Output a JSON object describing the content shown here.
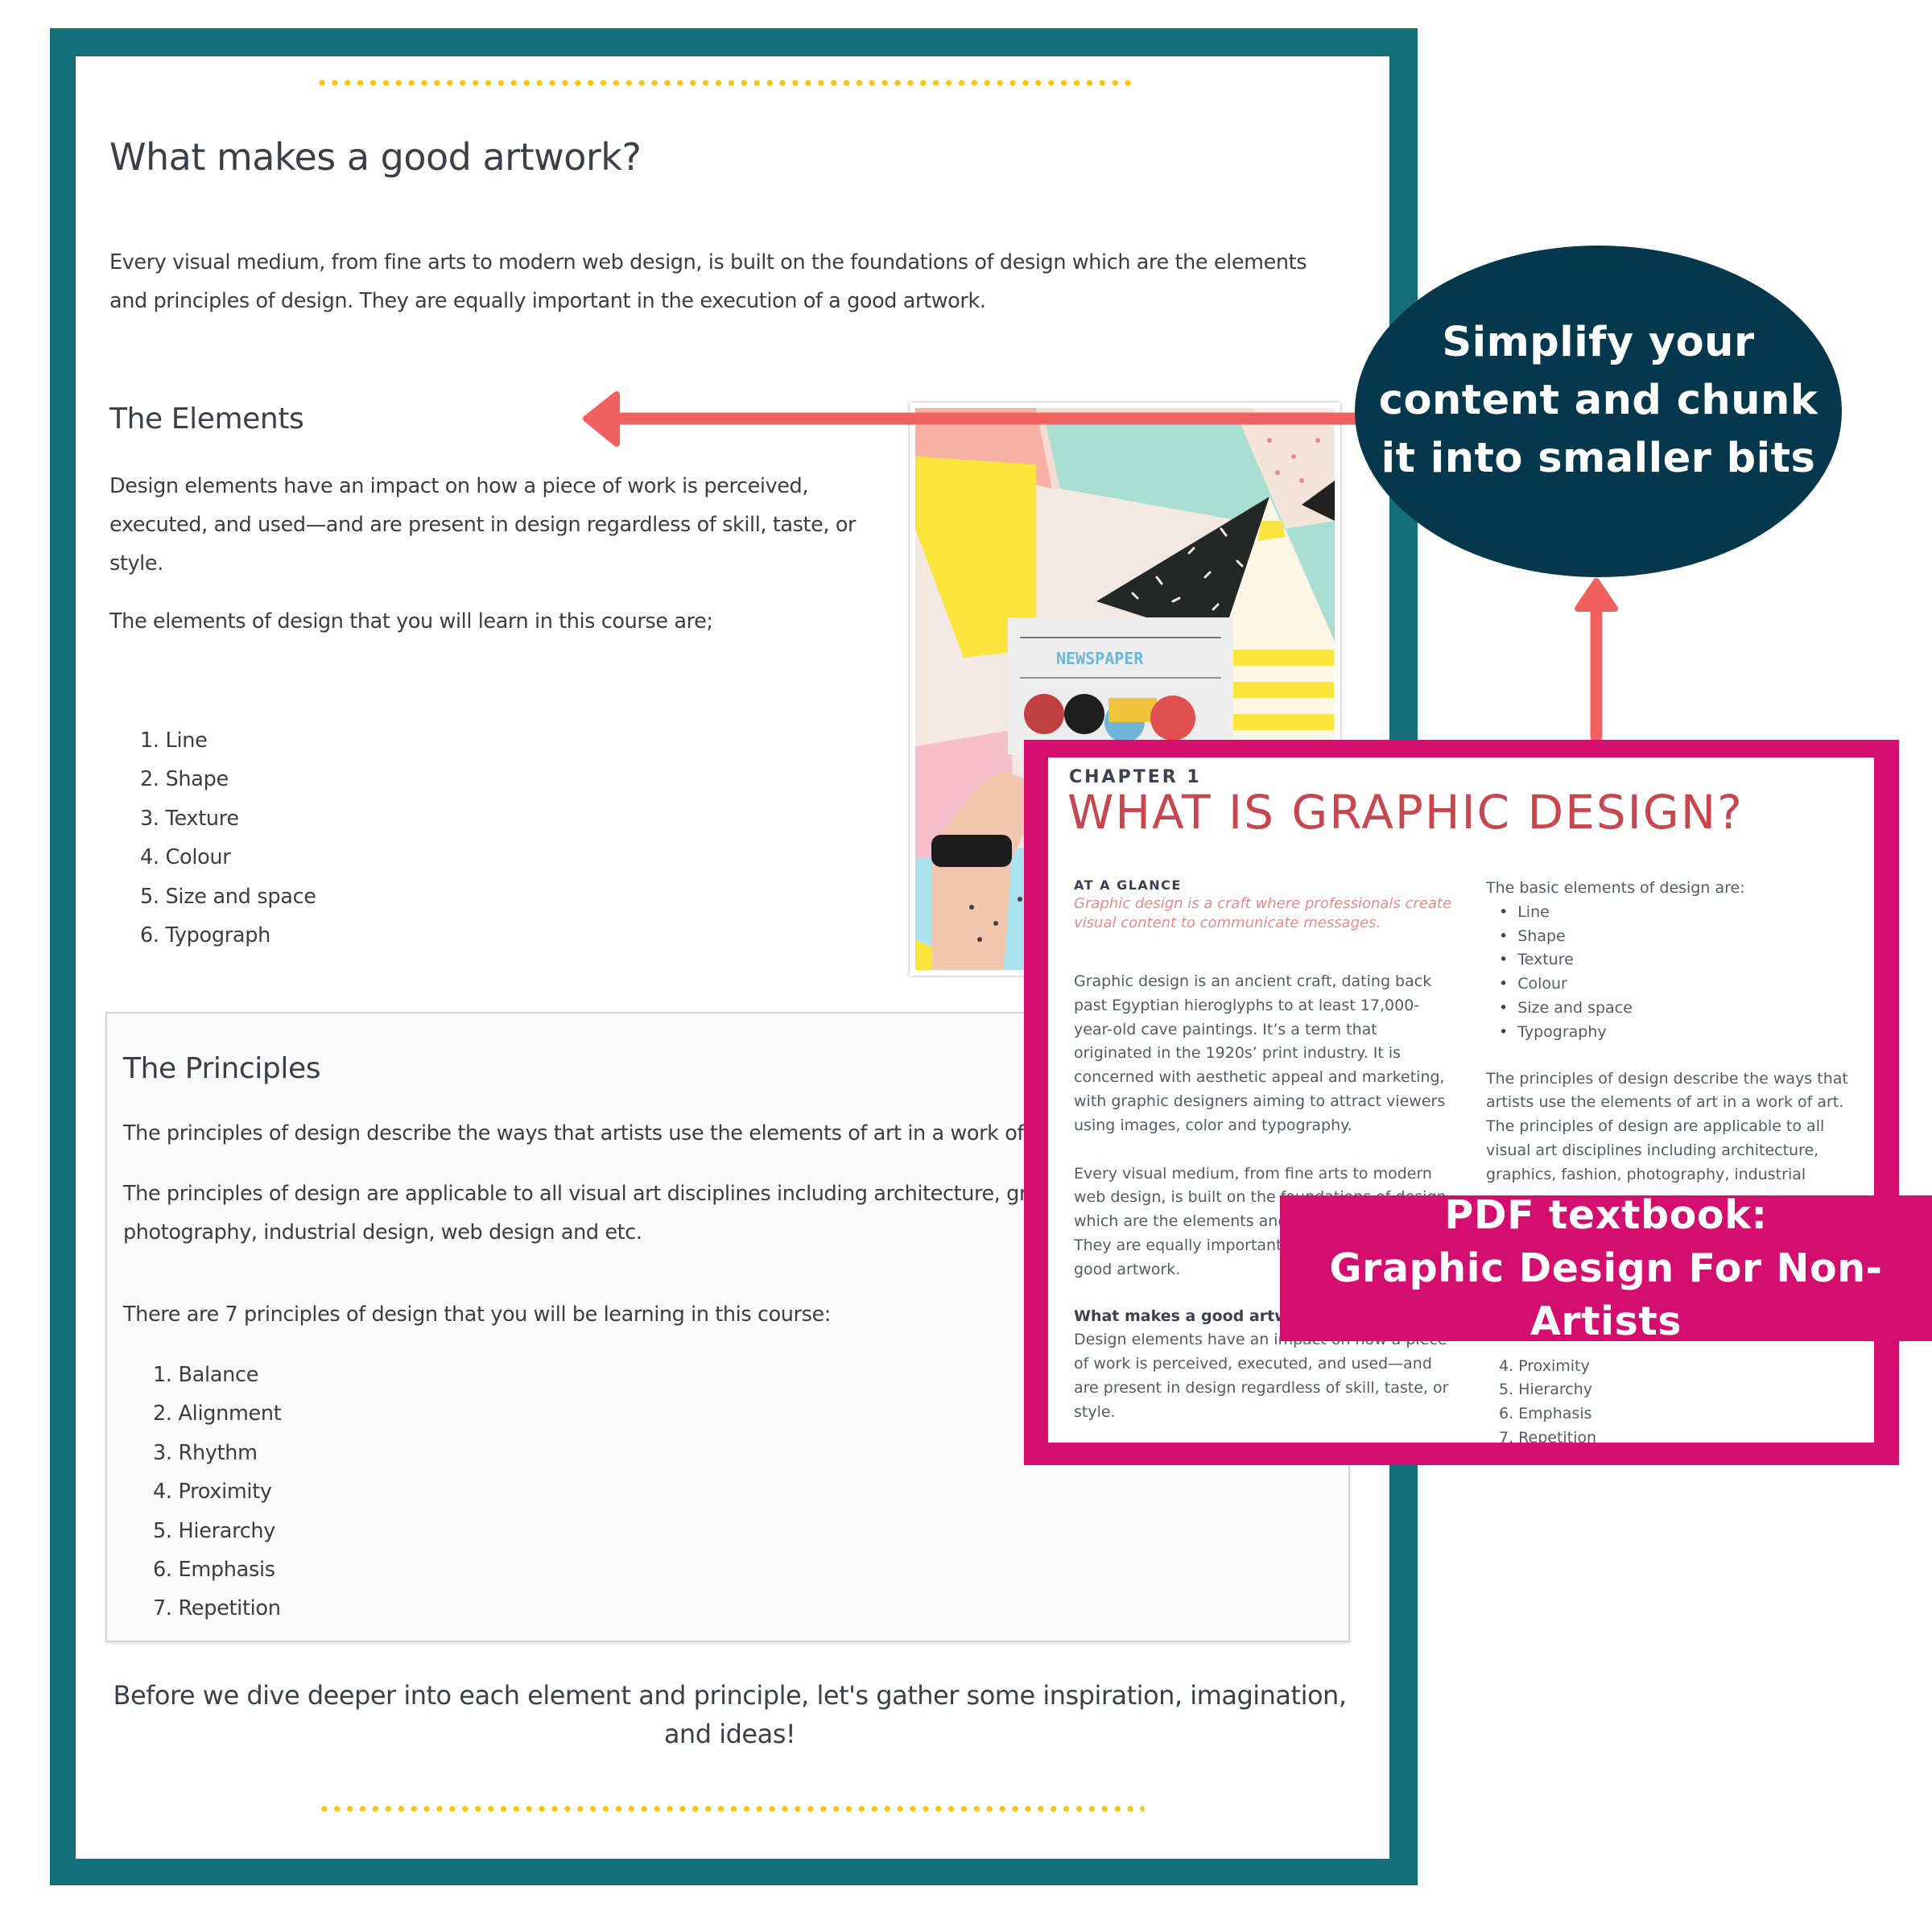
{
  "colors": {
    "frame_teal": "#136F7A",
    "callout_navy": "#06384D",
    "arrow_coral": "#F06262",
    "pdf_magenta": "#D40E6E",
    "divider_gold": "#F7C614",
    "pdf_title_red": "#C8474E"
  },
  "course_page": {
    "title": "What makes a good artwork?",
    "intro": "Every visual medium, from fine arts to modern web design, is built on the foundations of design which are the elements and principles of design. They are equally important in the execution of a good artwork.",
    "elements": {
      "heading": "The Elements",
      "description": "Design elements have an impact on how a piece of work is perceived, executed, and used—and are present in design regardless of skill, taste, or style.",
      "list_intro": "The elements of design that you will learn in this course are;",
      "items": [
        "1. Line",
        "2. Shape",
        "3. Texture",
        "4. Colour",
        "5. Size and space",
        "6. Typograph"
      ],
      "image": {
        "icon": "newspaper-photo",
        "caption_text": "NEWSPAPER"
      }
    },
    "principles": {
      "heading": "The Principles",
      "p1": "The principles of design describe the ways that artists use the elements of art in a work of art.",
      "p2": "The principles of design are applicable to all visual art disciplines including architecture, graphics, fashion, photography, industrial design, web design and etc.",
      "p3": "There are 7 principles of design that you will be learning in this course:",
      "items": [
        "1. Balance",
        "2. Alignment",
        "3. Rhythm",
        "4. Proximity",
        "5. Hierarchy",
        "6. Emphasis",
        "7. Repetition"
      ]
    },
    "closing": "Before we dive deeper into each element and principle, let's gather some inspiration, imagination, and ideas!"
  },
  "callout": {
    "lines": [
      "Simplify your",
      "content and chunk",
      "it into smaller bits"
    ]
  },
  "pdf_excerpt": {
    "chapter": "CHAPTER 1",
    "title": "WHAT IS GRAPHIC DESIGN?",
    "at_a_glance_label": "AT A GLANCE",
    "at_a_glance_text": "Graphic design is a craft where professionals create visual content to communicate messages.",
    "para1": "Graphic design is an ancient craft, dating back past Egyptian hieroglyphs to at least 17,000-year-old cave paintings. It’s a term that originated in the 1920s’ print industry. It is concerned with aesthetic appeal and marketing, with graphic designers aiming to attract viewers using images, color and typography.",
    "para2": "Every visual medium, from fine arts to modern web design, is built on the foundations of design which are the elements and principles of design. They are equally important in the execution of a good artwork.",
    "subheading": "What makes a good artwork?",
    "para3": "Design elements have an impact on how a piece of work is perceived, executed, and used—and are present in design regardless of skill, taste, or style.",
    "elements_intro": "The basic elements of design are:",
    "elements": [
      "Line",
      "Shape",
      "Texture",
      "Colour",
      "Size and space",
      "Typography"
    ],
    "principles_text": "The principles of design describe the ways that artists use the elements of art in a work of art. The principles of design are applicable to all visual art disciplines including architecture, graphics, fashion, photography, industrial",
    "principles_visible": [
      "4. Proximity",
      "5. Hierarchy",
      "6. Emphasis",
      "7. Repetition"
    ]
  },
  "banner": {
    "line1": "PDF textbook:",
    "line2": "Graphic Design For Non-Artists"
  }
}
